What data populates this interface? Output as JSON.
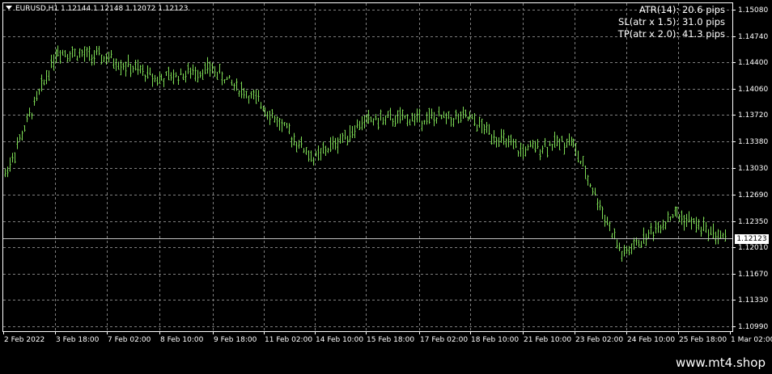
{
  "chart": {
    "symbol_line": "EURUSD,H1  1.12144 1.12148 1.12072 1.12123",
    "indicators": [
      "ATR(14): 20.6 pips",
      "SL(atr x 1.5): 31.0 pips",
      "TP(atr x 2.0): 41.3 pips"
    ],
    "current_price": "1.12123",
    "current_price_value": 1.12123,
    "price_axis": [
      "1.15080",
      "1.14740",
      "1.14400",
      "1.14060",
      "1.13720",
      "1.13380",
      "1.13030",
      "1.12690",
      "1.12350",
      "1.12010",
      "1.11670",
      "1.11330",
      "1.10990"
    ],
    "time_axis": [
      "2 Feb 2022",
      "3 Feb 18:00",
      "7 Feb 02:00",
      "8 Feb 10:00",
      "9 Feb 18:00",
      "11 Feb 02:00",
      "14 Feb 10:00",
      "15 Feb 18:00",
      "17 Feb 02:00",
      "18 Feb 10:00",
      "21 Feb 10:00",
      "23 Feb 02:00",
      "24 Feb 10:00",
      "25 Feb 18:00",
      "1 Mar 02:00"
    ],
    "colors": {
      "background": "#000000",
      "grid": "#7f7f7f",
      "bars": "#7ddc55",
      "axis": "#ffffff",
      "price_line": "#c0c0c0"
    }
  },
  "footer": {
    "watermark": "www.mt4.shop"
  },
  "chart_data": {
    "type": "line",
    "x": [
      "2 Feb 2022",
      "3 Feb 18:00",
      "7 Feb 02:00",
      "8 Feb 10:00",
      "9 Feb 18:00",
      "11 Feb 02:00",
      "14 Feb 10:00",
      "15 Feb 18:00",
      "17 Feb 02:00",
      "18 Feb 10:00",
      "21 Feb 10:00",
      "23 Feb 02:00",
      "24 Feb 10:00",
      "25 Feb 18:00",
      "1 Mar 02:00"
    ],
    "series": [
      {
        "values": [
          1.1295,
          1.1455,
          1.1445,
          1.1418,
          1.1432,
          1.1385,
          1.1315,
          1.1365,
          1.1368,
          1.1368,
          1.1325,
          1.134,
          1.119,
          1.1245,
          1.1212
        ]
      }
    ],
    "ylim": [
      1.1099,
      1.1508
    ],
    "grid": true
  }
}
